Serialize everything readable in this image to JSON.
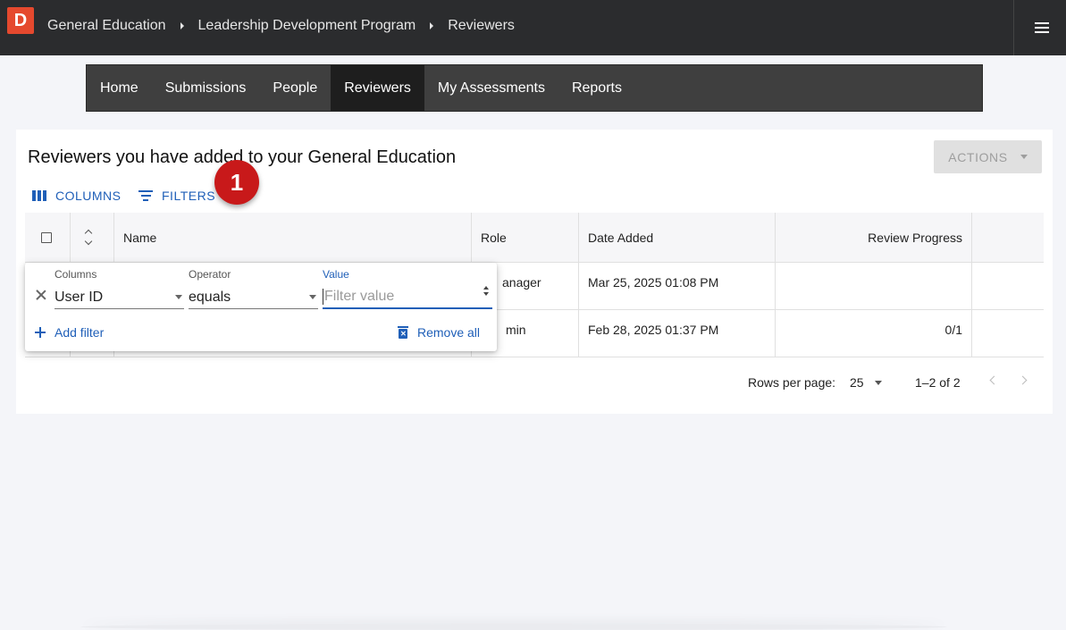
{
  "app": {
    "logo_letter": "D"
  },
  "breadcrumbs": [
    "General Education",
    "Leadership Development Program",
    "Reviewers"
  ],
  "nav": {
    "tabs": [
      {
        "label": "Home",
        "active": false
      },
      {
        "label": "Submissions",
        "active": false
      },
      {
        "label": "People",
        "active": false
      },
      {
        "label": "Reviewers",
        "active": true
      },
      {
        "label": "My Assessments",
        "active": false
      },
      {
        "label": "Reports",
        "active": false
      }
    ]
  },
  "card": {
    "title": "Reviewers you have added to your General Education",
    "actions_label": "ACTIONS",
    "columns_label": "COLUMNS",
    "filters_label": "FILTERS",
    "step_badge": "1"
  },
  "table": {
    "headers": {
      "name": "Name",
      "role": "Role",
      "date_added": "Date Added",
      "review_progress": "Review Progress"
    },
    "rows": [
      {
        "role": "anager",
        "date_added": "Mar 25, 2025 01:08 PM",
        "review_progress": ""
      },
      {
        "role": "min",
        "date_added": "Feb 28, 2025 01:37 PM",
        "review_progress": "0/1"
      }
    ]
  },
  "pagination": {
    "rows_per_page_label": "Rows per page:",
    "rows_per_page": "25",
    "range": "1–2 of 2"
  },
  "filter_panel": {
    "columns_label": "Columns",
    "columns_value": "User ID",
    "operator_label": "Operator",
    "operator_value": "equals",
    "value_label": "Value",
    "value_placeholder": "Filter value",
    "add_filter_label": "Add filter",
    "remove_all_label": "Remove all"
  },
  "colors": {
    "accent": "#1f5fb8",
    "logo": "#e5492e",
    "badge": "#c8191a",
    "topbar": "#2b2c2e",
    "nav": "#3f3f3f"
  }
}
